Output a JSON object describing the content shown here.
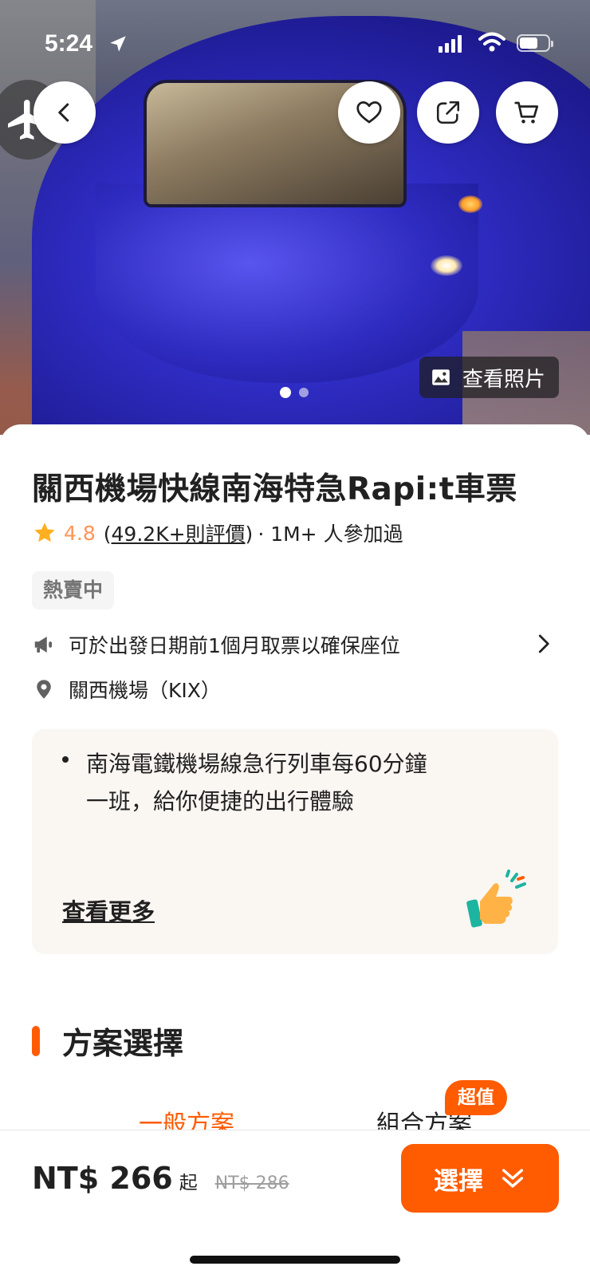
{
  "status_bar": {
    "time": "5:24"
  },
  "hero": {
    "photo_button_label": "查看照片",
    "carousel": {
      "count": 2,
      "active": 1
    }
  },
  "product": {
    "title": "關西機場快線南海特急Rapi:t車票",
    "rating": "4.8",
    "reviews_open": "(",
    "reviews_link": "49.2K+則評價",
    "reviews_close": ")",
    "participants": "· 1M+ 人參加過",
    "tag": "熱賣中",
    "notice": "可於出發日期前1個月取票以確保座位",
    "location": "關西機場（KIX）"
  },
  "highlight": {
    "text": "南海電鐵機場線急行列車每60分鐘一班，給你便捷的出行體驗",
    "more": "查看更多"
  },
  "plans": {
    "section_title": "方案選擇",
    "tabs": [
      "一般方案",
      "組合方案"
    ],
    "badge": "超值"
  },
  "footer": {
    "price": "NT$ 266",
    "price_suffix": "起",
    "original_price": "NT$ 286",
    "select_label": "選擇"
  },
  "colors": {
    "brand": "#ff5b00",
    "rating": "#ff9557"
  }
}
